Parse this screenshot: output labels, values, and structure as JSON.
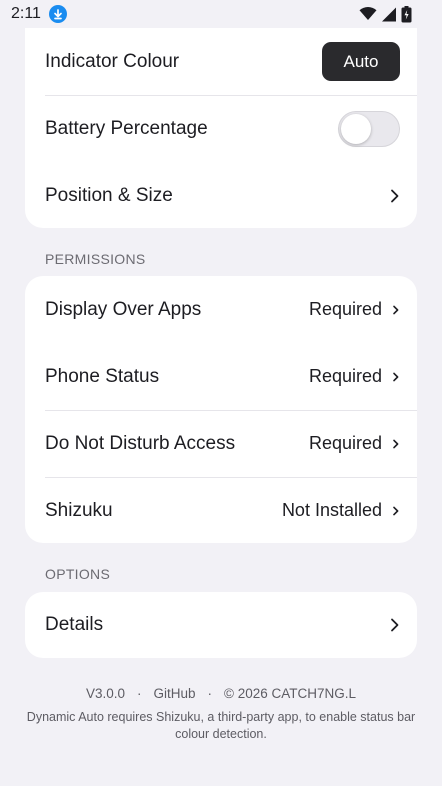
{
  "status_bar": {
    "time": "2:11",
    "icons": [
      "download-icon",
      "wifi-icon",
      "signal-icon",
      "battery-icon"
    ]
  },
  "display_card": {
    "indicator_colour": {
      "label": "Indicator Colour",
      "button_label": "Auto"
    },
    "battery_percentage": {
      "label": "Battery Percentage",
      "toggle_on": false
    },
    "position_size": {
      "label": "Position & Size"
    }
  },
  "permissions": {
    "header": "PERMISSIONS",
    "items": [
      {
        "label": "Display Over Apps",
        "value": "Required"
      },
      {
        "label": "Phone Status",
        "value": "Required"
      },
      {
        "label": "Do Not Disturb Access",
        "value": "Required"
      },
      {
        "label": "Shizuku",
        "value": "Not Installed"
      }
    ]
  },
  "options": {
    "header": "OPTIONS",
    "items": [
      {
        "label": "Details"
      }
    ]
  },
  "footer": {
    "version": "V3.0.0",
    "separator": "·",
    "github": "GitHub",
    "copyright": "© 2026 CATCH7NG.L",
    "description": "Dynamic Auto requires Shizuku, a third-party app, to enable status bar colour detection."
  },
  "colors": {
    "background": "#f2f1f6",
    "card": "#ffffff",
    "accent_button": "#2a2a2d",
    "download_badge": "#1a8cf0"
  }
}
